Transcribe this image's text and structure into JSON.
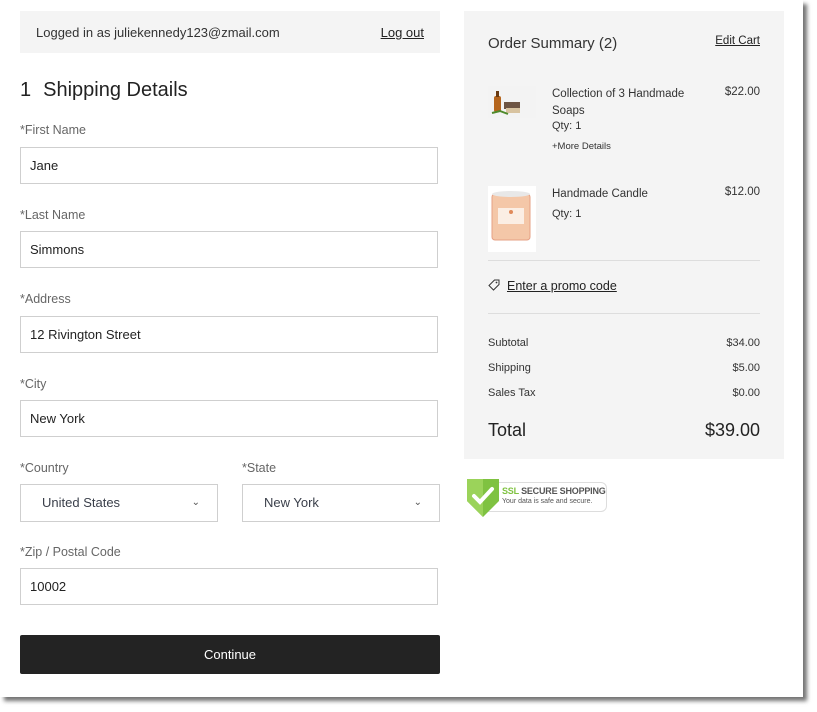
{
  "header": {
    "logged_in_text": "Logged in as juliekennedy123@zmail.com",
    "logout_label": "Log out"
  },
  "shipping": {
    "step_number": "1",
    "title": "Shipping Details",
    "fields": {
      "first_name": {
        "label": "*First Name",
        "value": "Jane"
      },
      "last_name": {
        "label": "*Last Name",
        "value": "Simmons"
      },
      "address": {
        "label": "*Address",
        "value": "12 Rivington Street"
      },
      "city": {
        "label": "*City",
        "value": "New York"
      },
      "country": {
        "label": "*Country",
        "value": "United States"
      },
      "state": {
        "label": "*State",
        "value": "New York"
      },
      "zip": {
        "label": "*Zip / Postal Code",
        "value": "10002"
      }
    },
    "continue_label": "Continue"
  },
  "order_summary": {
    "title": "Order Summary (2)",
    "edit_cart_label": "Edit Cart",
    "items": [
      {
        "name": "Collection of 3 Handmade Soaps",
        "price": "$22.00",
        "qty": "Qty: 1",
        "more_details": "+More Details",
        "image": "soap-product-image"
      },
      {
        "name": "Handmade Candle",
        "price": "$12.00",
        "qty": "Qty: 1",
        "image": "candle-product-image"
      }
    ],
    "promo_label": "Enter a promo code",
    "subtotal": {
      "label": "Subtotal",
      "value": "$34.00"
    },
    "shipping": {
      "label": "Shipping",
      "value": "$5.00"
    },
    "sales_tax": {
      "label": "Sales Tax",
      "value": "$0.00"
    },
    "total": {
      "label": "Total",
      "value": "$39.00"
    }
  },
  "ssl_badge": {
    "title_accent": "SSL",
    "title_rest": "SECURE SHOPPING",
    "subtitle": "Your data is safe and secure.",
    "accent_color": "#7fc241"
  }
}
